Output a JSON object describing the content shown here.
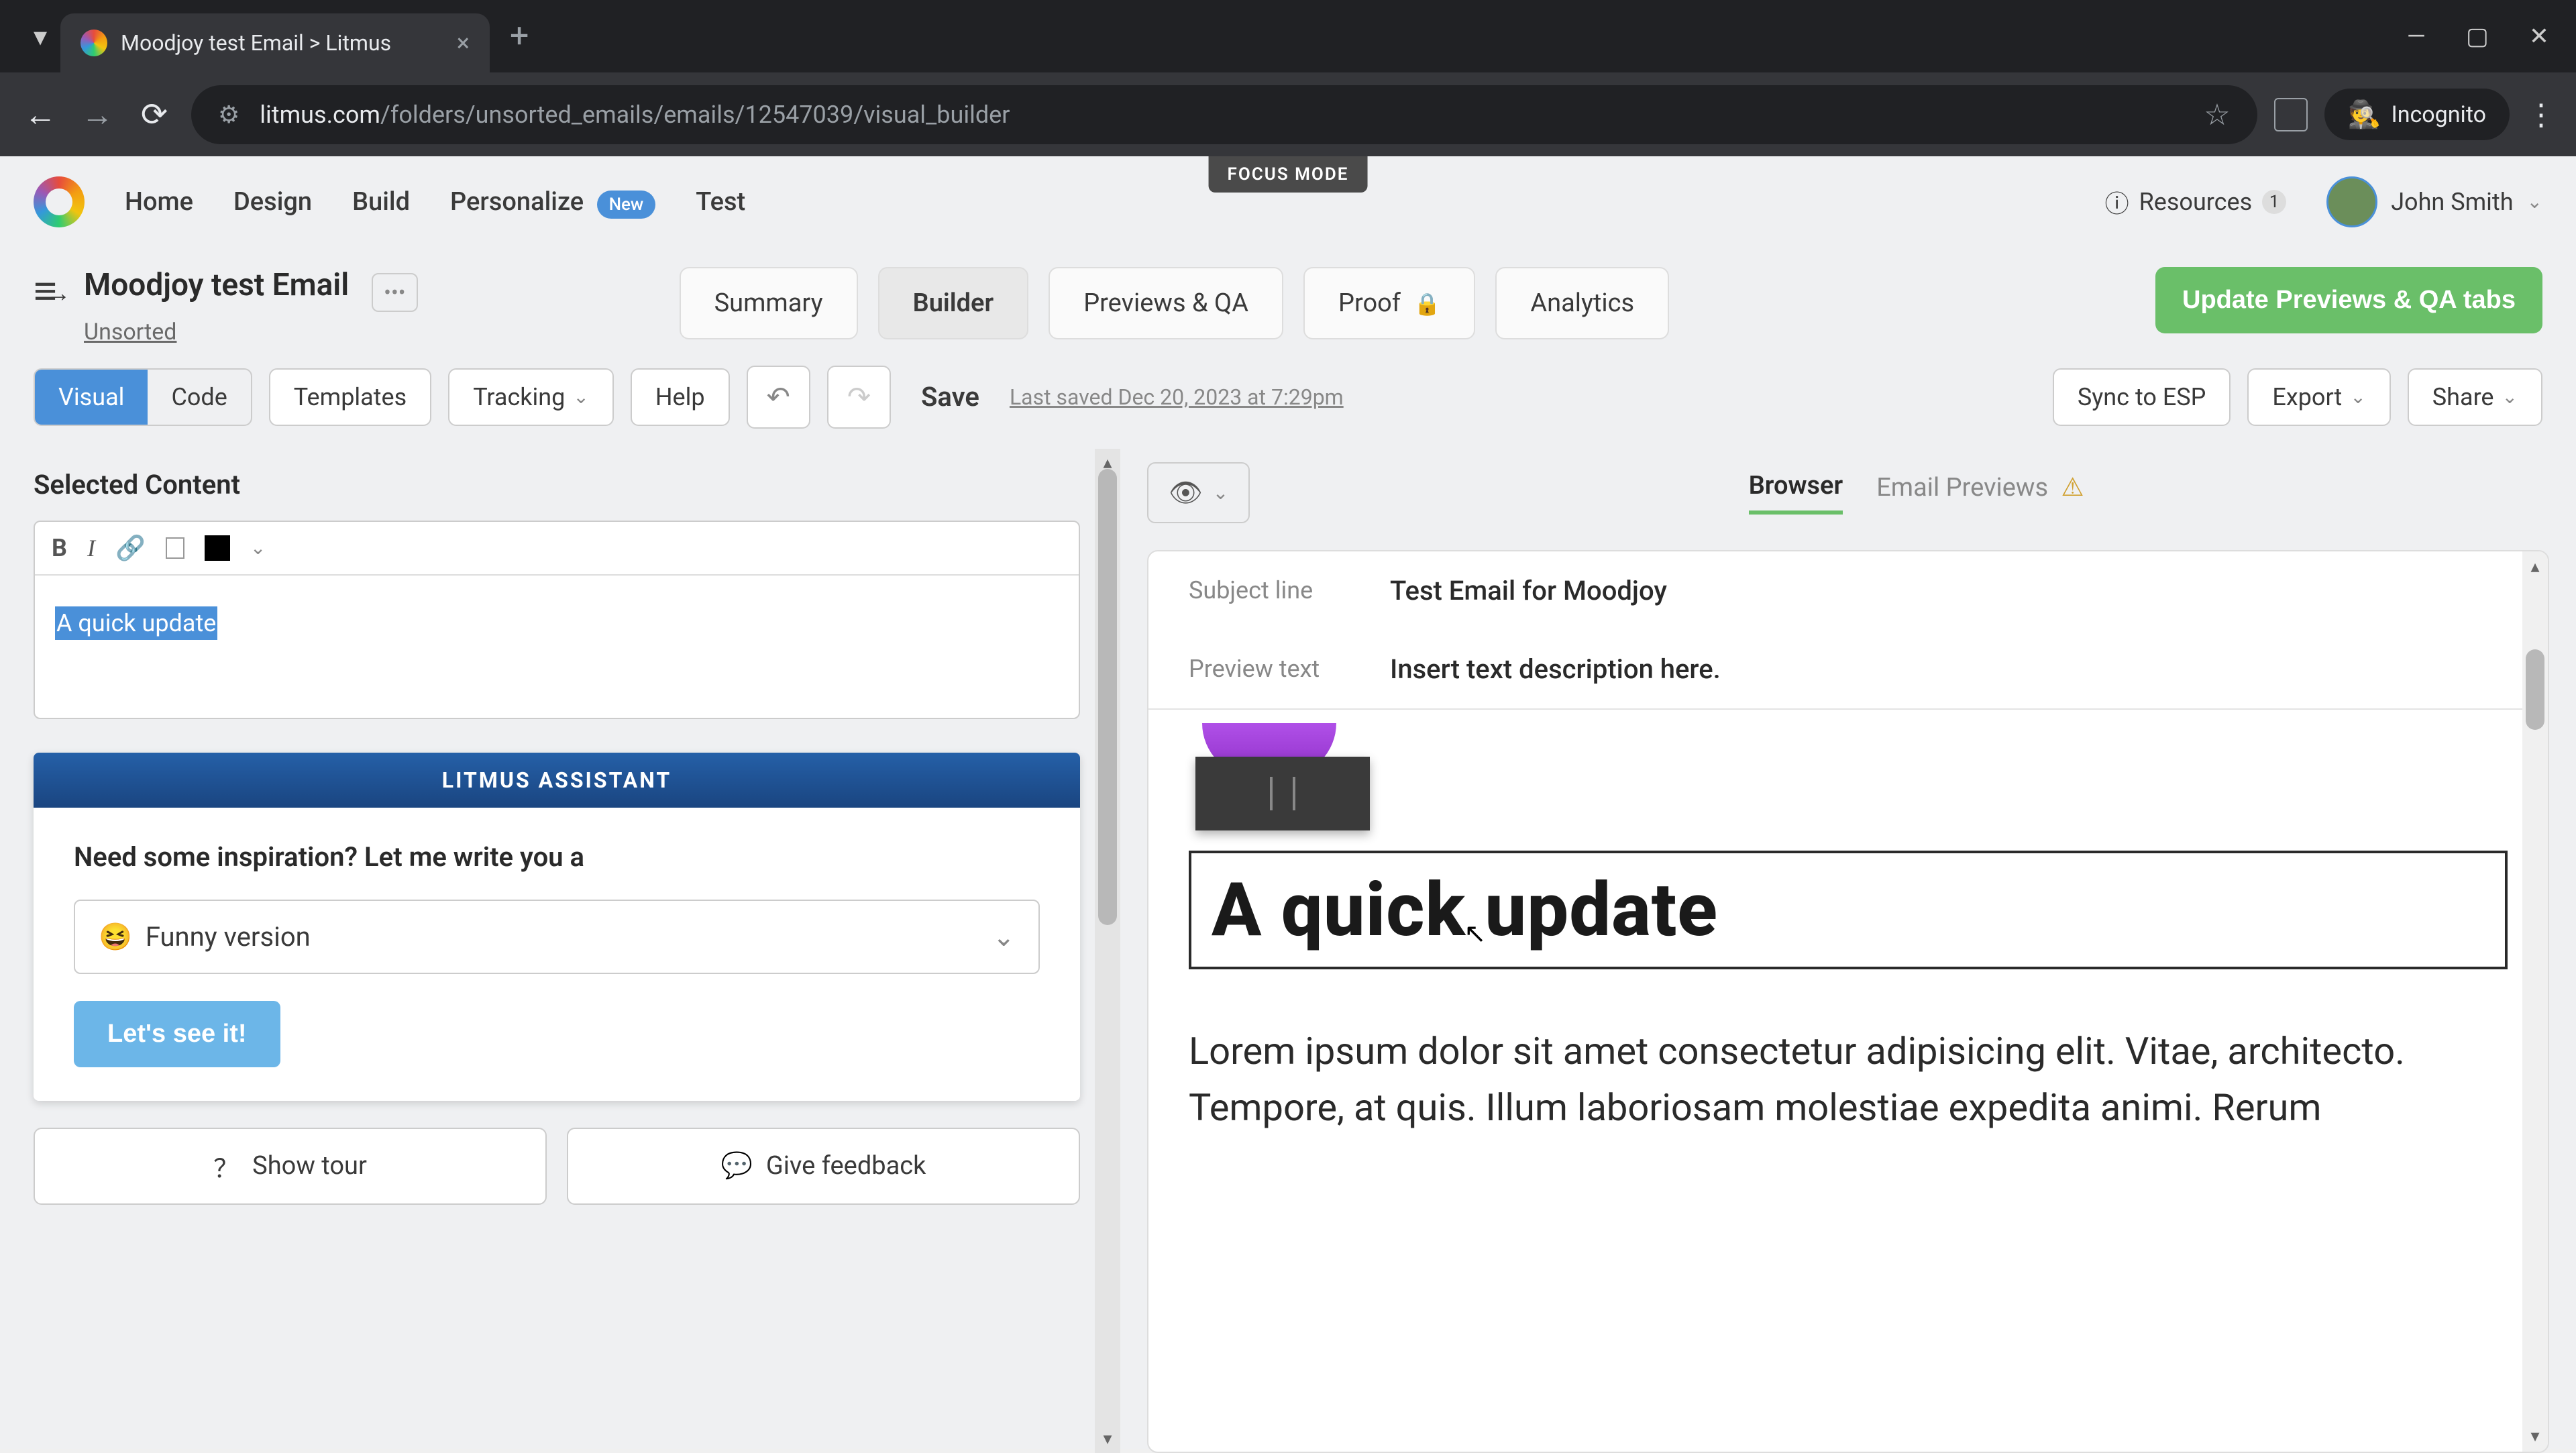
{
  "browser": {
    "tab_title": "Moodjoy test Email > Litmus",
    "url_domain": "litmus.com",
    "url_path": "/folders/unsorted_emails/emails/12547039/visual_builder",
    "incognito_label": "Incognito"
  },
  "app": {
    "focus_mode": "FOCUS MODE",
    "nav": {
      "home": "Home",
      "design": "Design",
      "build": "Build",
      "personalize": "Personalize",
      "personalize_badge": "New",
      "test": "Test",
      "resources": "Resources",
      "resources_count": "1",
      "user_name": "John Smith"
    },
    "title": {
      "email_name": "Moodjoy test Email",
      "folder": "Unsorted"
    },
    "main_tabs": {
      "summary": "Summary",
      "builder": "Builder",
      "previews": "Previews & QA",
      "proof": "Proof",
      "analytics": "Analytics"
    },
    "update_btn": "Update Previews & QA tabs",
    "toolbar": {
      "visual": "Visual",
      "code": "Code",
      "templates": "Templates",
      "tracking": "Tracking",
      "help": "Help",
      "save": "Save",
      "last_saved": "Last saved Dec 20, 2023 at 7:29pm",
      "sync": "Sync to ESP",
      "export": "Export",
      "share": "Share"
    }
  },
  "editor": {
    "section_title": "Selected Content",
    "content_text": "A quick update"
  },
  "assistant": {
    "header": "LITMUS ASSISTANT",
    "prompt": "Need some inspiration? Let me write you a",
    "option_emoji": "😆",
    "option_label": "Funny version",
    "cta": "Let's see it!"
  },
  "bottom": {
    "show_tour": "Show tour",
    "feedback": "Give feedback"
  },
  "preview": {
    "tab_browser": "Browser",
    "tab_email": "Email Previews",
    "subject_label": "Subject line",
    "subject_value": "Test Email for Moodjoy",
    "preview_label": "Preview text",
    "preview_value": "Insert text description here.",
    "headline": "A quick update",
    "body": "Lorem ipsum dolor sit amet consectetur adipisicing elit. Vitae, architecto. Tempore, at quis. Illum laboriosam molestiae expedita animi. Rerum"
  }
}
